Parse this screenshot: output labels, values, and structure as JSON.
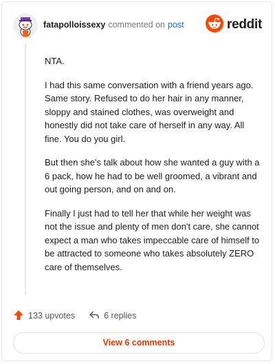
{
  "header": {
    "username": "fatapolloissexy",
    "commented_text": "commented on",
    "post_link": "post",
    "brand": "reddit",
    "avatar_icon": "snoo-avatar-icon",
    "brand_icon": "reddit-logo-icon",
    "brand_color": "#ff4500"
  },
  "comment": {
    "paragraphs": [
      "NTA.",
      "I had this same conversation with a friend years ago. Same story. Refused to do her hair in any manner, sloppy and stained clothes, was overweight and honestly did not take care of herself in any way. All fine. You do you girl.",
      "But then she's talk about how she wanted a guy with a 6 pack, how he had to be well groomed, a vibrant and out going person, and on and on.",
      "Finally I just had to tell her that while her weight was not the issue and plenty of men don't care, she cannot expect a man who takes impeccable care of himself to be attracted to someone who takes absolutely ZERO care of themselves."
    ]
  },
  "actions": {
    "upvotes": "133 upvotes",
    "replies": "6 replies",
    "upvote_icon": "upvote-arrow-icon",
    "reply_icon": "reply-arrow-icon",
    "upvote_color": "#ff4500"
  },
  "footer": {
    "view_comments": "View 6 comments",
    "accent_color": "#d93a00"
  }
}
